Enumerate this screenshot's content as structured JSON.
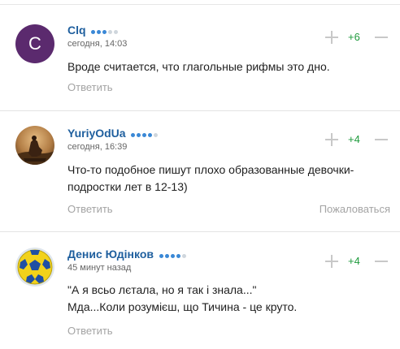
{
  "comments": [
    {
      "avatar_letter": "C",
      "username": "Clq",
      "rating_dots": 3,
      "timestamp": "сегодня, 14:03",
      "score": "+6",
      "body_lines": [
        "Вроде считается, что глагольные рифмы это дно."
      ],
      "reply_label": "Ответить"
    },
    {
      "username": "YuriyOdUa",
      "rating_dots": 4,
      "timestamp": "сегодня, 16:39",
      "score": "+4",
      "body_lines": [
        "Что-то подобное пишут плохо образованные девочки-",
        "подростки лет в 12-13)"
      ],
      "reply_label": "Ответить",
      "complain_label": "Пожаловаться"
    },
    {
      "username": "Денис Юдінков",
      "rating_dots": 4,
      "timestamp": "45 минут назад",
      "score": "+4",
      "body_lines": [
        "\"А я всьо лєтала, но я так і знала...\"",
        "Мда...Коли розумієш, що Тичина - це круто."
      ],
      "reply_label": "Ответить"
    }
  ],
  "colors": {
    "username": "#1f5f9e",
    "score_positive": "#1e9a3c",
    "muted": "#a4a4a4",
    "rating_on": "#3a88d6",
    "rating_off": "#cfd6dc",
    "avatar_c_bg": "#5b2a6e"
  },
  "icons": {
    "upvote": "plus-icon",
    "downvote": "minus-icon"
  }
}
